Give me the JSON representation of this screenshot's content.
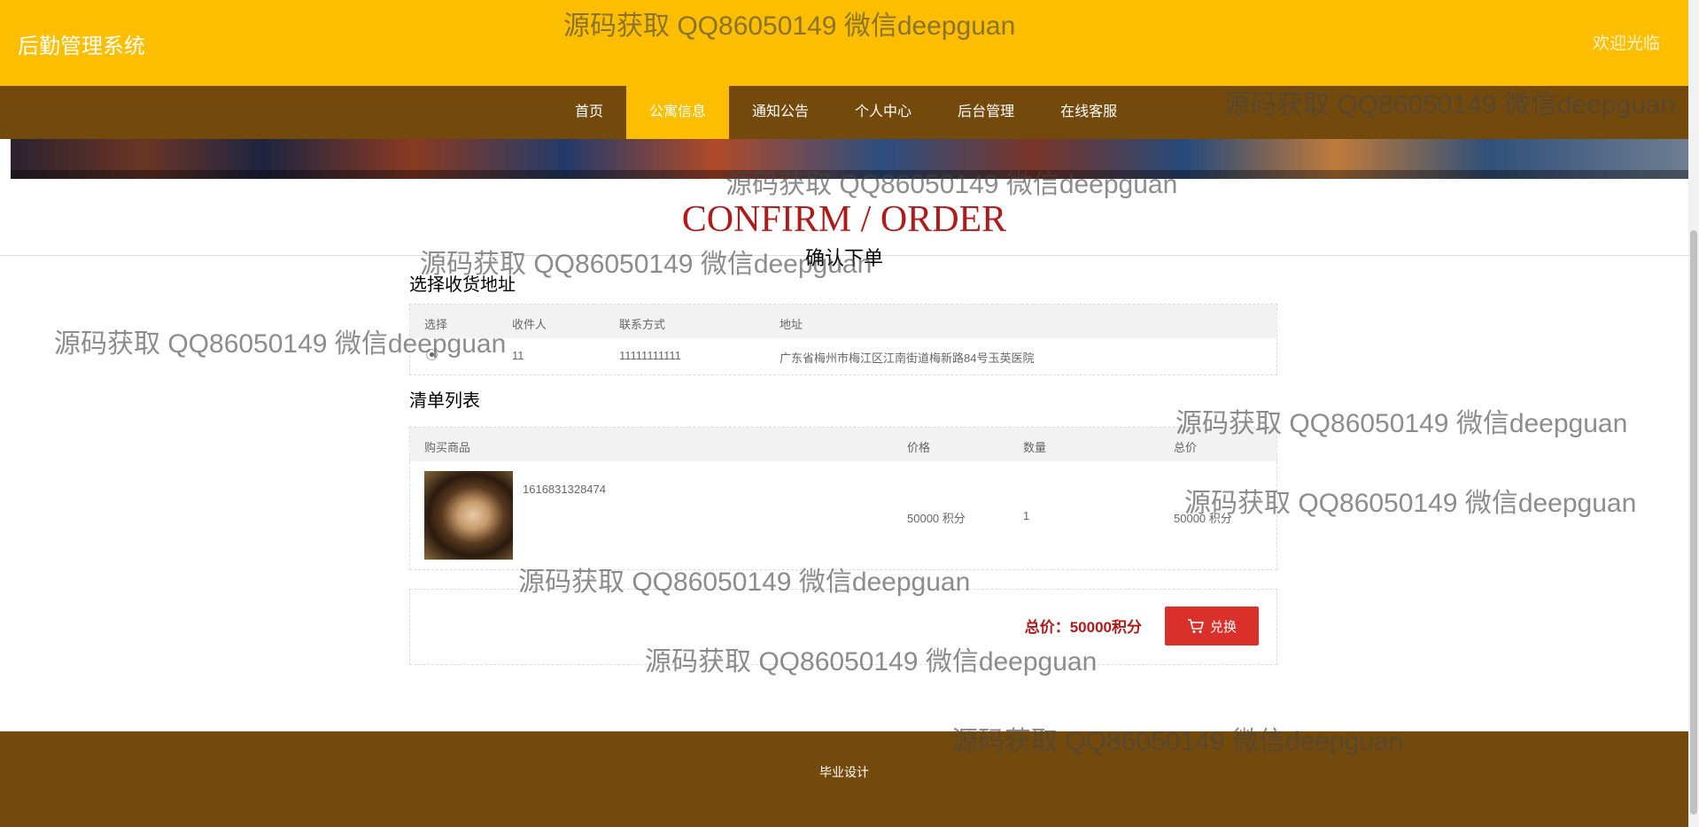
{
  "header": {
    "brand": "后勤管理系统",
    "welcome": "欢迎光临"
  },
  "nav": {
    "items": [
      {
        "label": "首页",
        "active": false
      },
      {
        "label": "公寓信息",
        "active": true
      },
      {
        "label": "通知公告",
        "active": false
      },
      {
        "label": "个人中心",
        "active": false
      },
      {
        "label": "后台管理",
        "active": false
      },
      {
        "label": "在线客服",
        "active": false
      }
    ]
  },
  "page": {
    "title_en": "CONFIRM / ORDER",
    "title_cn": "确认下单"
  },
  "address": {
    "section_title": "选择收货地址",
    "columns": [
      "选择",
      "收件人",
      "联系方式",
      "地址"
    ],
    "rows": [
      {
        "selected": true,
        "recipient": "11",
        "phone": "11111111111",
        "address": "广东省梅州市梅江区江南街道梅新路84号玉英医院"
      }
    ]
  },
  "order_list": {
    "section_title": "清单列表",
    "columns": [
      "购买商品",
      "价格",
      "数量",
      "总价"
    ],
    "items": [
      {
        "name": "1616831328474",
        "price": "50000 积分",
        "quantity": "1",
        "total": "50000 积分"
      }
    ]
  },
  "summary": {
    "total_label": "总价：50000积分",
    "exchange_label": "兑换"
  },
  "footer": {
    "text": "毕业设计"
  },
  "watermark": {
    "text": "源码获取 QQ86050149 微信deepguan"
  },
  "colors": {
    "topbar": "#fdbe00",
    "navbar": "#744a0c",
    "accent_red": "#b01a1a",
    "button": "#d9302a"
  },
  "icons": {
    "cart": "cart-icon"
  }
}
